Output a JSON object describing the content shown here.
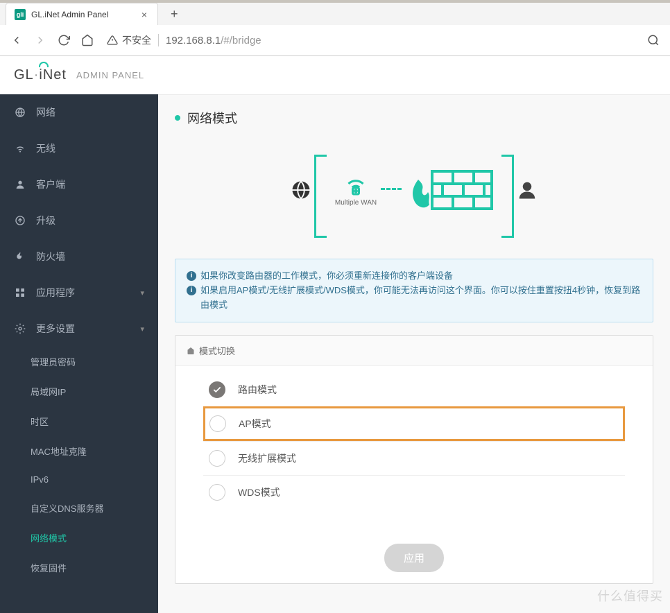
{
  "browser": {
    "tab_title": "GL.iNet Admin Panel",
    "favicon_text": "gli",
    "security_label": "不安全",
    "url_host": "192.168.8.1",
    "url_path": "/#/bridge"
  },
  "header": {
    "logo_text": "GL·iNet",
    "admin_label": "ADMIN PANEL"
  },
  "sidebar": {
    "items": [
      {
        "label": "网络",
        "icon": "globe"
      },
      {
        "label": "无线",
        "icon": "wifi"
      },
      {
        "label": "客户端",
        "icon": "user"
      },
      {
        "label": "升级",
        "icon": "arrow-up-circle"
      },
      {
        "label": "防火墙",
        "icon": "flame"
      },
      {
        "label": "应用程序",
        "icon": "grid",
        "chevron": true
      },
      {
        "label": "更多设置",
        "icon": "gear",
        "chevron": true,
        "expanded": true
      }
    ],
    "subitems": [
      "管理员密码",
      "局域网IP",
      "时区",
      "MAC地址克隆",
      "IPv6",
      "自定义DNS服务器",
      "网络模式",
      "恢复固件"
    ],
    "active_sub": "网络模式"
  },
  "page": {
    "title": "网络模式",
    "diagram_label": "Multiple WAN",
    "alert_line1": "如果你改变路由器的工作模式，你必须重新连接你的客户端设备",
    "alert_line2": "如果启用AP模式/无线扩展模式/WDS模式，你可能无法再访问这个界面。你可以按住重置按扭4秒钟，恢复到路由模式",
    "panel_title": "模式切换",
    "modes": [
      {
        "label": "路由模式",
        "checked": true
      },
      {
        "label": "AP模式",
        "checked": false,
        "highlight": true
      },
      {
        "label": "无线扩展模式",
        "checked": false
      },
      {
        "label": "WDS模式",
        "checked": false
      }
    ],
    "apply_label": "应用"
  },
  "watermark": "什么值得买"
}
